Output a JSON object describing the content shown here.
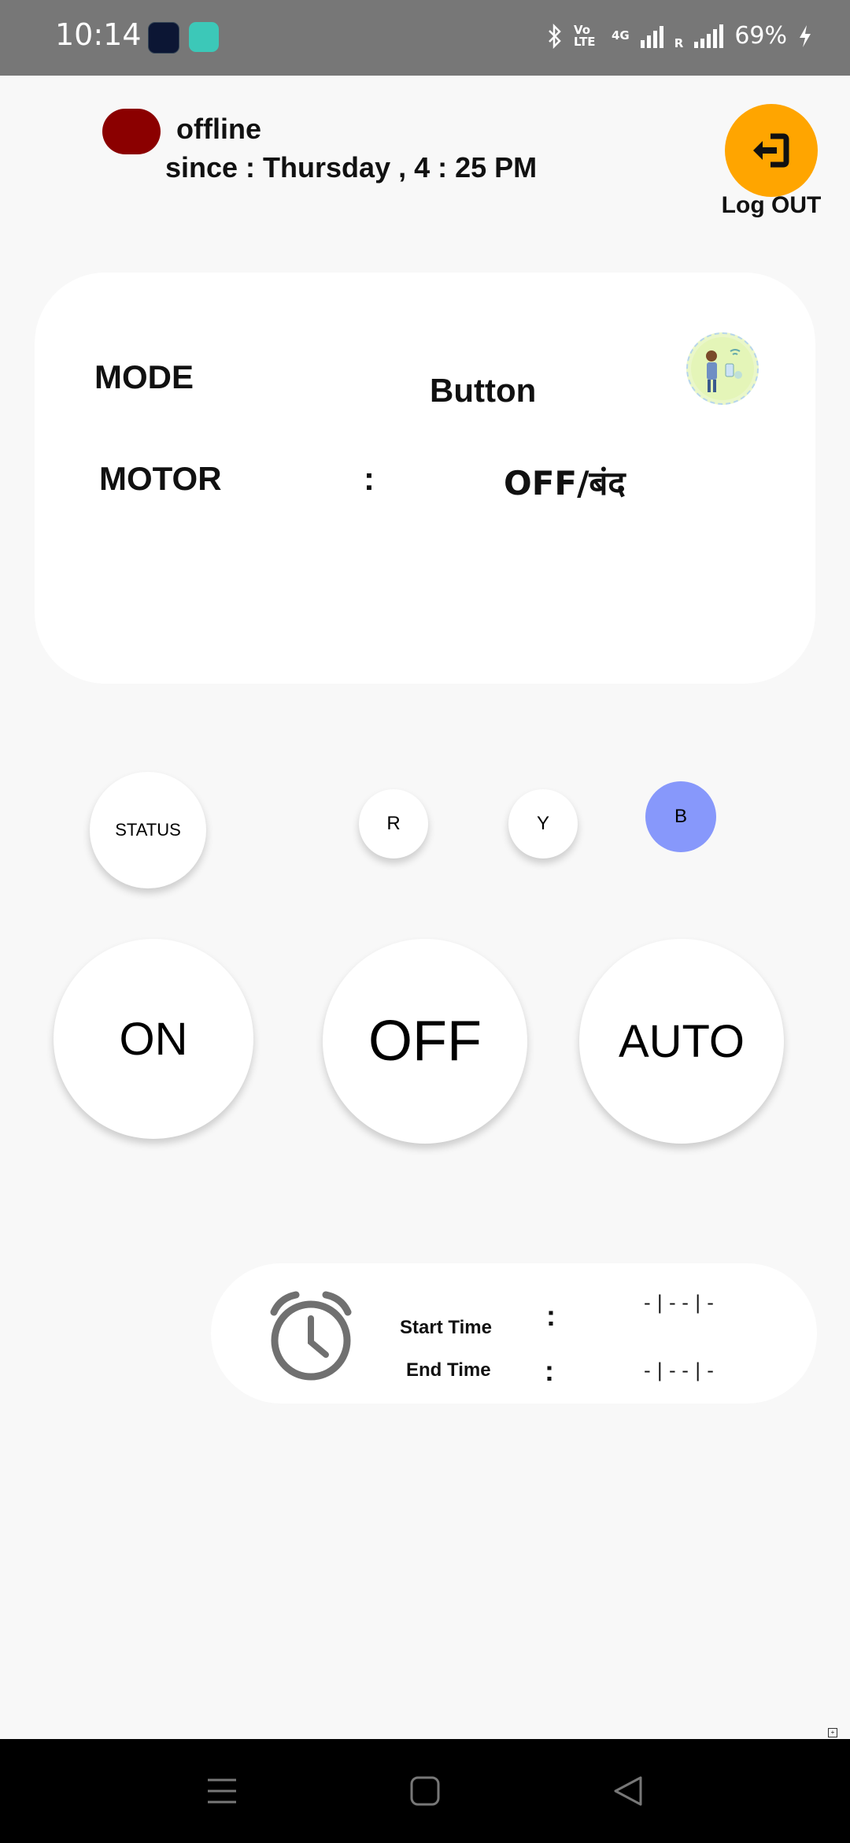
{
  "status_bar": {
    "time": "10:14",
    "volte": "Vo LTE",
    "network": "4G",
    "roaming": "R",
    "battery": "69%"
  },
  "connection": {
    "status": "offline",
    "since": "since : Thursday , 4 : 25 PM",
    "dot_color": "#8b0000"
  },
  "logout": {
    "label": "Log OUT",
    "color": "#ffa500",
    "icon": "logout-icon"
  },
  "info_card": {
    "mode_label": "MODE",
    "mode_value": "Button",
    "motor_label": "MOTOR",
    "motor_separator": ":",
    "motor_value": "OFF/बंद"
  },
  "phase_buttons": {
    "status": "STATUS",
    "r": "R",
    "y": "Y",
    "b": "B",
    "active_color": "#8798fb"
  },
  "controls": {
    "on": "ON",
    "off": "OFF",
    "auto": "AUTO"
  },
  "timer": {
    "start_label": "Start Time",
    "end_label": "End Time",
    "separator": ":",
    "start_value": "- | - - | -",
    "end_value": "- | - - | -"
  }
}
